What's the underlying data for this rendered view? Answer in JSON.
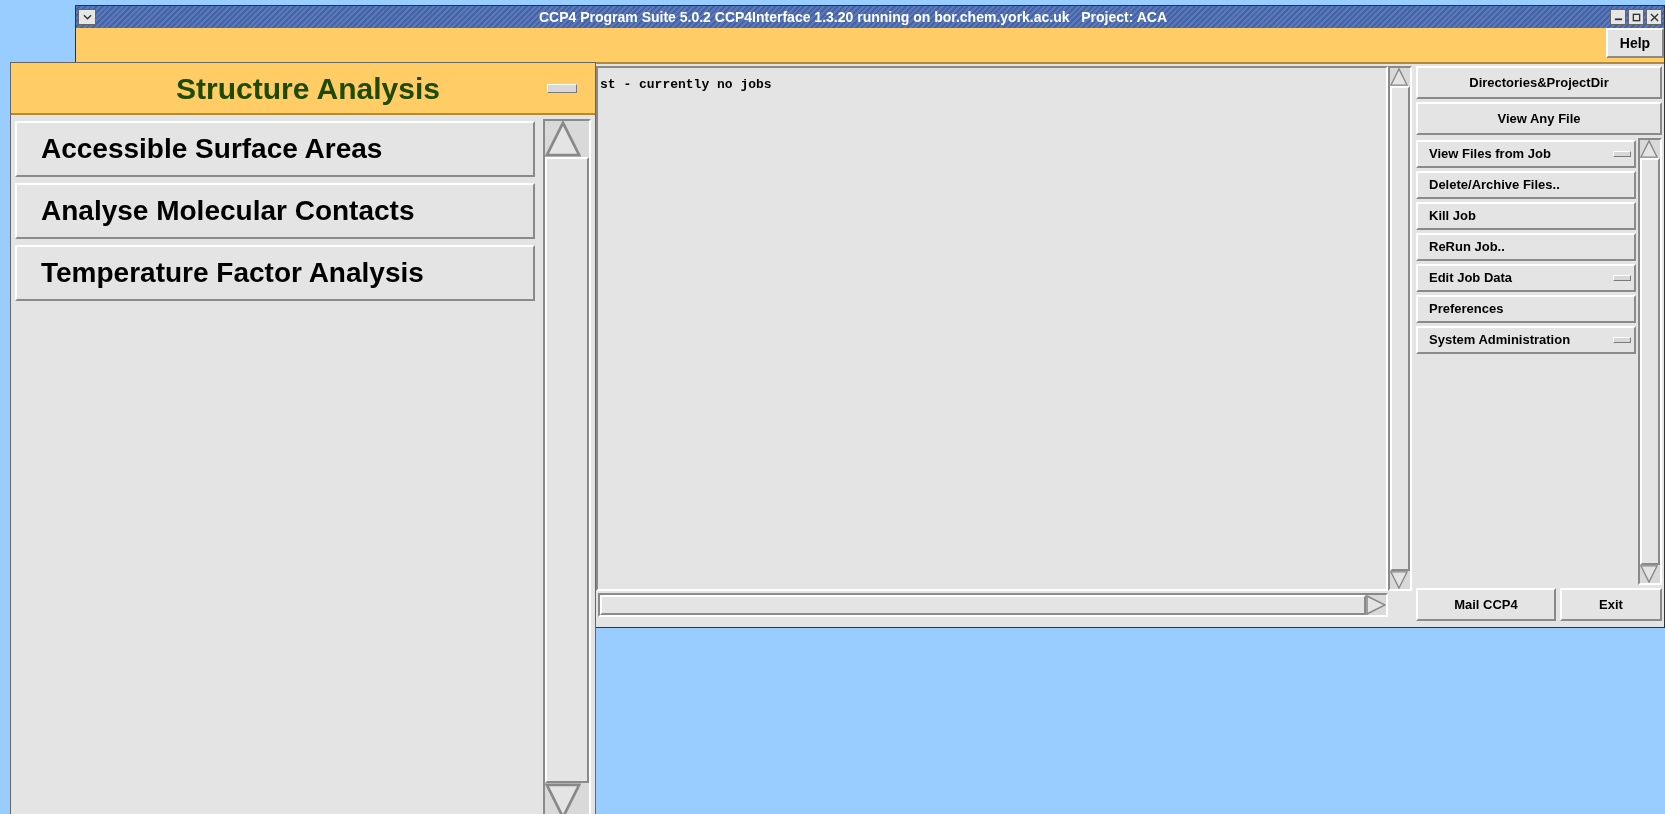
{
  "window": {
    "title": "CCP4 Program Suite 5.0.2 CCP4Interface 1.3.20 running on bor.chem.york.ac.uk   Project: ACA"
  },
  "menu_bar": {
    "help": "Help"
  },
  "job_list": {
    "text": "st - currently no jobs"
  },
  "top_buttons": [
    {
      "label": "Directories&ProjectDir"
    },
    {
      "label": "View Any File"
    }
  ],
  "tool_buttons": [
    {
      "label": "View Files from Job",
      "kind": "menu"
    },
    {
      "label": "Delete/Archive Files..",
      "kind": "button"
    },
    {
      "label": "Kill Job",
      "kind": "button"
    },
    {
      "label": "ReRun Job..",
      "kind": "button"
    },
    {
      "label": "Edit Job Data",
      "kind": "menu"
    },
    {
      "label": "Preferences",
      "kind": "button"
    },
    {
      "label": "System Administration",
      "kind": "menu"
    }
  ],
  "bottom_buttons": [
    {
      "label": "Mail CCP4"
    },
    {
      "label": "Exit"
    }
  ],
  "module_panel": {
    "title": "Structure Analysis",
    "items": [
      {
        "label": "Accessible Surface Areas"
      },
      {
        "label": "Analyse Molecular Contacts"
      },
      {
        "label": "Temperature Factor Analysis"
      }
    ]
  }
}
